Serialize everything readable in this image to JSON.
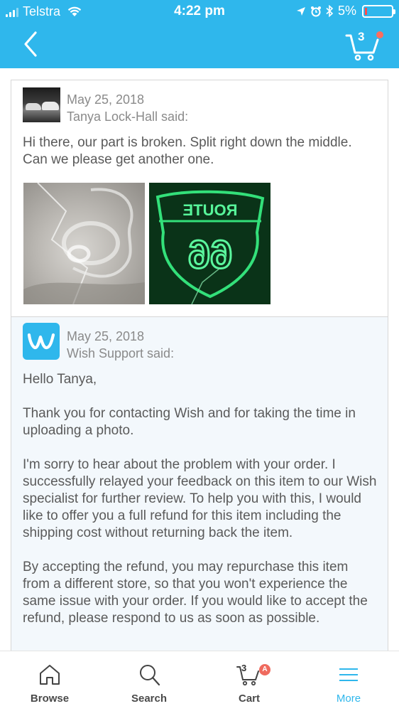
{
  "status_bar": {
    "carrier": "Telstra",
    "time": "4:22 pm",
    "battery": "5%"
  },
  "header": {
    "cart_count": "3"
  },
  "messages": [
    {
      "date": "May 25, 2018",
      "author": "Tanya Lock-Hall said:",
      "body": [
        "Hi there, our part is broken. Split right down the middle. Can we please get another one."
      ]
    },
    {
      "date": "May 25, 2018",
      "author": "Wish Support said:",
      "body": [
        "Hello Tanya,",
        "Thank you for contacting Wish and for taking the time in uploading a photo.",
        "I'm sorry to hear about the problem with your order. I successfully relayed your feedback on this item to our Wish specialist for further review. To help you with this, I would like to offer you a full refund for this item including the shipping cost without returning back the item.",
        "By accepting the refund, you may repurchase this item from a different store, so that you won't experience the same issue with your order. If you would like to accept the refund, please respond to us as soon as possible."
      ]
    }
  ],
  "tabs": [
    {
      "label": "Browse",
      "icon": "home-icon"
    },
    {
      "label": "Search",
      "icon": "search-icon"
    },
    {
      "label": "Cart",
      "icon": "cart-icon",
      "count": "3",
      "badge": "A"
    },
    {
      "label": "More",
      "icon": "menu-icon",
      "active": true
    }
  ],
  "colors": {
    "brand": "#2fb7ec",
    "badge": "#ef6a5e",
    "support_bg": "#f3f8fc"
  },
  "photo_overlay": {
    "neon_text": "ROUTE",
    "neon_number": "66"
  }
}
